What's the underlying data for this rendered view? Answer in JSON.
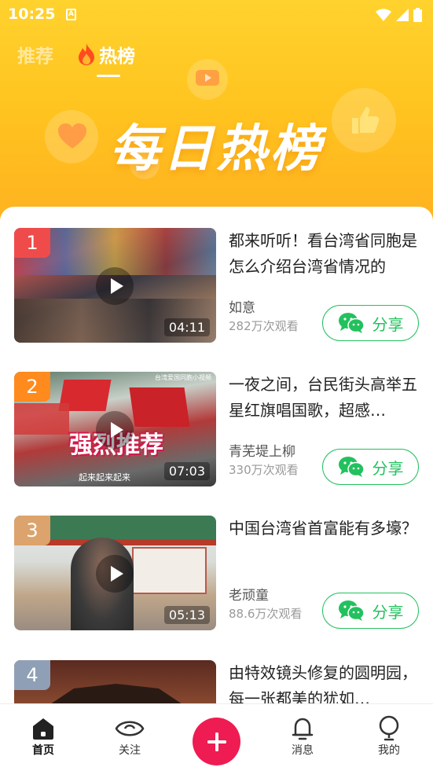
{
  "status_bar": {
    "time": "10:25",
    "notification_glyph": "A"
  },
  "tabs": [
    {
      "label": "推荐",
      "active": false
    },
    {
      "label": "热榜",
      "active": true,
      "icon": "fire-icon"
    }
  ],
  "banner": {
    "title": "每日热榜"
  },
  "items": [
    {
      "rank": "1",
      "rank_color": "#f04b4b",
      "title": "都来听听！看台湾省同胞是怎么介绍台湾省情况的",
      "author": "如意",
      "views": "282万次观看",
      "duration": "04:11",
      "share_label": "分享"
    },
    {
      "rank": "2",
      "rank_color": "#ff8a1e",
      "title": "一夜之间，台民街头高举五星红旗唱国歌，超感…",
      "author": "青芜堤上柳",
      "views": "330万次观看",
      "duration": "07:03",
      "share_label": "分享",
      "thumb_overlay": "强烈推荐",
      "thumb_caption": "起来起来起来",
      "thumb_top_caption": "台湾爱国同胞小视频"
    },
    {
      "rank": "3",
      "rank_color": "#dca36c",
      "title": "中国台湾省首富能有多壕？",
      "author": "老顽童",
      "views": "88.6万次观看",
      "duration": "05:13",
      "share_label": "分享"
    },
    {
      "rank": "4",
      "rank_color": "#8fa0b6",
      "title": "由特效镜头修复的圆明园，每一张都美的犹如…"
    }
  ],
  "bottom_nav": [
    {
      "label": "首页",
      "icon": "home-icon",
      "active": true
    },
    {
      "label": "关注",
      "icon": "eye-icon",
      "active": false
    },
    {
      "label": "",
      "icon": "plus-icon",
      "active": false
    },
    {
      "label": "消息",
      "icon": "bell-icon",
      "active": false
    },
    {
      "label": "我的",
      "icon": "bulb-icon",
      "active": false
    }
  ],
  "colors": {
    "accent_green": "#22c15e",
    "plus_red": "#ee1c52",
    "hero_yellow": "#ffc41f"
  }
}
